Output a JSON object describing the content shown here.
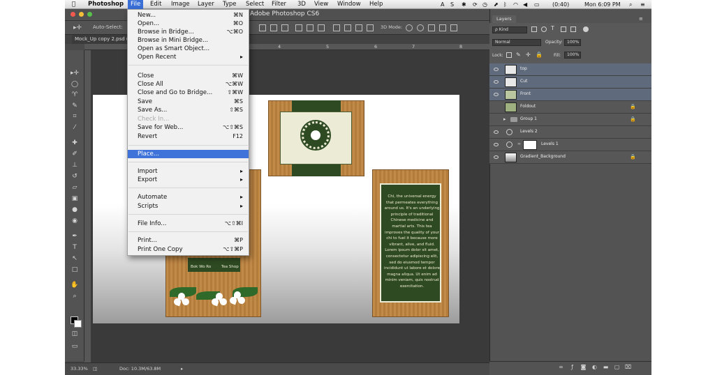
{
  "menubar": {
    "apple": "",
    "app": "Photoshop",
    "items": [
      "File",
      "Edit",
      "Image",
      "Layer",
      "Type",
      "Select",
      "Filter",
      "3D",
      "View",
      "Window",
      "Help"
    ],
    "tray": {
      "battery": "(0:40)",
      "clock": "Mon 6:09 PM"
    }
  },
  "window": {
    "title": "Adobe Photoshop CS6"
  },
  "options_bar": {
    "auto_select": "Auto-Select:",
    "mode_3d": "3D Mode:"
  },
  "document": {
    "tab": "Mock_Up copy 2.psd @",
    "ruler": [
      "4",
      "5",
      "6",
      "7",
      "8"
    ]
  },
  "file_menu": {
    "items": [
      {
        "label": "New...",
        "shortcut": "⌘N",
        "state": "normal"
      },
      {
        "label": "Open...",
        "shortcut": "⌘O",
        "state": "normal"
      },
      {
        "label": "Browse in Bridge...",
        "shortcut": "⌥⌘O",
        "state": "normal"
      },
      {
        "label": "Browse in Mini Bridge...",
        "shortcut": "",
        "state": "normal"
      },
      {
        "label": "Open as Smart Object...",
        "shortcut": "",
        "state": "normal"
      },
      {
        "label": "Open Recent",
        "shortcut": "▸",
        "state": "normal"
      },
      {
        "label": "Close",
        "shortcut": "⌘W",
        "state": "normal"
      },
      {
        "label": "Close All",
        "shortcut": "⌥⌘W",
        "state": "normal"
      },
      {
        "label": "Close and Go to Bridge...",
        "shortcut": "⇧⌘W",
        "state": "normal"
      },
      {
        "label": "Save",
        "shortcut": "⌘S",
        "state": "normal"
      },
      {
        "label": "Save As...",
        "shortcut": "⇧⌘S",
        "state": "normal"
      },
      {
        "label": "Check In...",
        "shortcut": "",
        "state": "disabled"
      },
      {
        "label": "Save for Web...",
        "shortcut": "⌥⇧⌘S",
        "state": "normal"
      },
      {
        "label": "Revert",
        "shortcut": "F12",
        "state": "normal"
      },
      {
        "label": "Place...",
        "shortcut": "",
        "state": "highlighted"
      },
      {
        "label": "Import",
        "shortcut": "▸",
        "state": "normal"
      },
      {
        "label": "Export",
        "shortcut": "▸",
        "state": "normal"
      },
      {
        "label": "Automate",
        "shortcut": "▸",
        "state": "normal"
      },
      {
        "label": "Scripts",
        "shortcut": "▸",
        "state": "normal"
      },
      {
        "label": "File Info...",
        "shortcut": "⌥⇧⌘I",
        "state": "normal"
      },
      {
        "label": "Print...",
        "shortcut": "⌘P",
        "state": "normal"
      },
      {
        "label": "Print One Copy",
        "shortcut": "⌥⇧⌘P",
        "state": "normal"
      }
    ]
  },
  "layers_panel": {
    "tab": "Layers",
    "kind": "ρ Kind",
    "blend_mode": "Normal",
    "opacity_label": "Opacity:",
    "opacity": "100%",
    "lock_label": "Lock:",
    "fill_label": "Fill:",
    "fill": "100%",
    "layers": [
      {
        "name": "top",
        "selected": true,
        "locked": false
      },
      {
        "name": "Cut",
        "selected": true,
        "locked": false
      },
      {
        "name": "Front",
        "selected": true,
        "locked": false
      },
      {
        "name": "Foldout",
        "selected": false,
        "locked": true
      },
      {
        "name": "Group 1",
        "selected": false,
        "locked": true
      },
      {
        "name": "Levels 2",
        "selected": false,
        "locked": false
      },
      {
        "name": "Levels 1",
        "selected": false,
        "locked": false
      },
      {
        "name": "Gradient_Background",
        "selected": false,
        "locked": true
      }
    ]
  },
  "canvas": {
    "label_left": "Bok Wo Ro",
    "label_right": "Tea Shop",
    "body_text": "Chi, the universal energy that permeates everything around us. It's an underlying principle of traditional Chinese medicine and martial arts. This tea improves the quality of your chi to fuel it because more vibrant, alive, and fluid. Lorem ipsum dolor sit amet, consectetur adipiscing elit, sed do eiusmod tempor incididunt ut labore et dolore magna aliqua. Ut enim ad minim veniam, quis nostrud exercitation."
  },
  "status": {
    "zoom": "33.33%",
    "doc": "Doc: 10.3M/63.8M"
  }
}
